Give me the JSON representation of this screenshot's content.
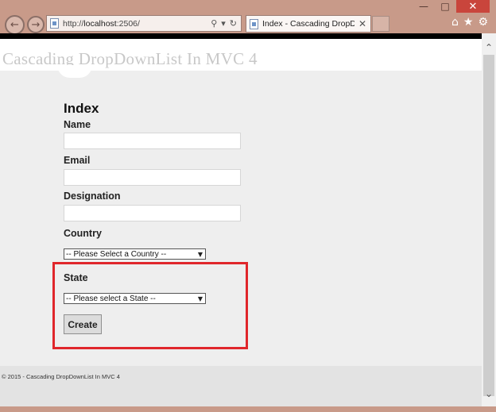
{
  "browser": {
    "url_prefix": "http://",
    "url_host": "localhost",
    "url_suffix": ":2506/",
    "tab_title": "Index - Cascading DropDo...",
    "icons": {
      "back": "back-arrow-icon",
      "forward": "forward-arrow-icon",
      "search": "search-icon",
      "refresh": "refresh-icon",
      "close_tab": "close-icon",
      "home": "home-icon",
      "favorites": "star-icon",
      "settings": "gear-icon"
    },
    "window_controls": [
      "minimize",
      "maximize",
      "close"
    ]
  },
  "site": {
    "title": "Cascading DropDownList In MVC 4"
  },
  "form": {
    "heading": "Index",
    "fields": {
      "name_label": "Name",
      "email_label": "Email",
      "designation_label": "Designation",
      "country_label": "Country",
      "state_label": "State"
    },
    "values": {
      "name": "",
      "email": "",
      "designation": ""
    },
    "country_selected": "-- Please Select a Country --",
    "state_selected": "-- Please select a State --",
    "create_label": "Create"
  },
  "footer": {
    "text": "© 2015 - Cascading DropDownList In MVC 4"
  },
  "colors": {
    "highlight": "#e0262b",
    "main_background": "#eeeeee",
    "footer_background": "#e3e3e3",
    "frame": "#c89a89"
  }
}
